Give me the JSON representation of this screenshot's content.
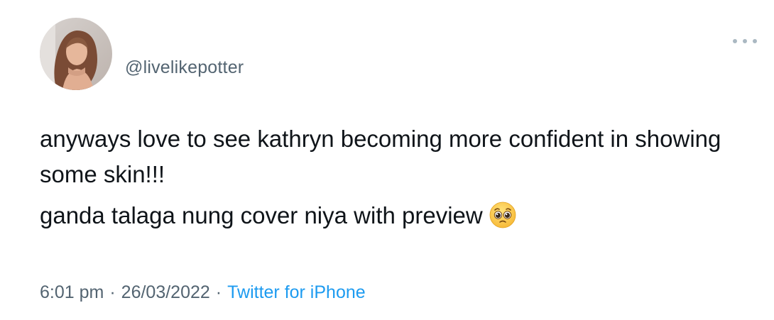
{
  "tweet": {
    "handle": "@livelikepotter",
    "avatar_icon": "profile-photo",
    "more_icon": "more-dots-icon",
    "paragraphs": [
      "anyways love to see kathryn becoming more confident in showing some skin!!!",
      "ganda talaga nung cover niya with preview"
    ],
    "emoji": "pleading-face-emoji",
    "time": "6:01 pm",
    "date": "26/03/2022",
    "separator": "·",
    "source": "Twitter for iPhone",
    "colors": {
      "text": "#0f1419",
      "muted": "#536471",
      "link": "#1d9bf0"
    }
  }
}
